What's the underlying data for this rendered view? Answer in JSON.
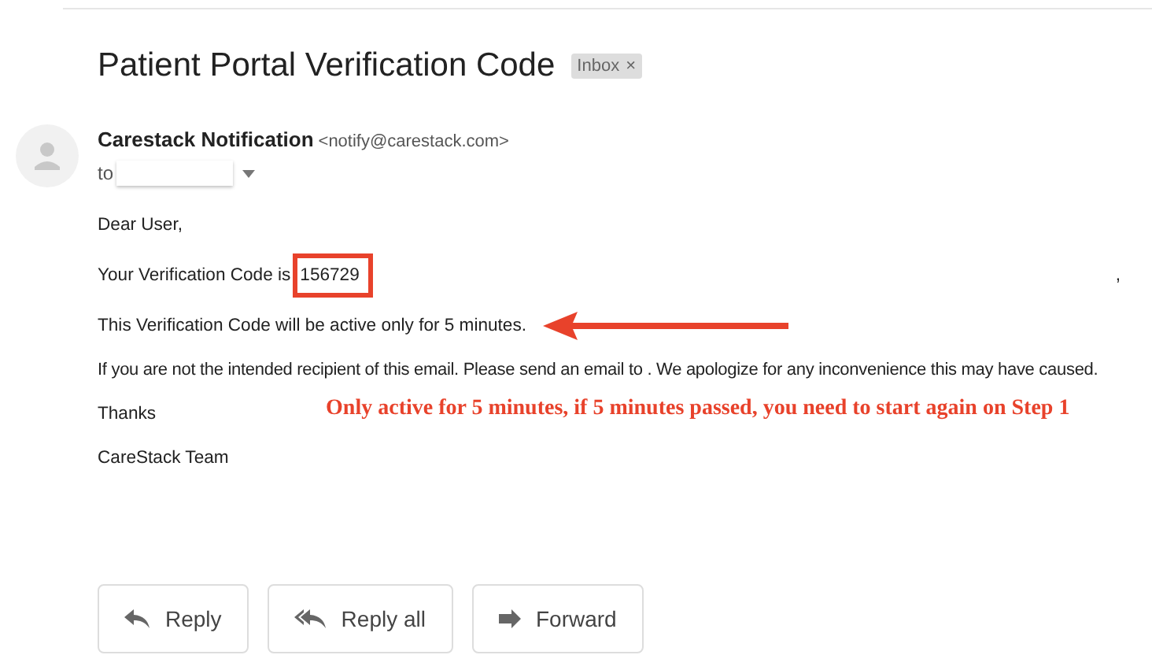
{
  "subject": "Patient Portal Verification Code",
  "label": {
    "text": "Inbox",
    "close": "×"
  },
  "sender": {
    "name": "Carestack Notification",
    "email": "<notify@carestack.com>",
    "to_label": "to"
  },
  "body": {
    "greeting": "Dear User,",
    "code_prefix": "Your Verification Code is",
    "code": "156729",
    "stray_mark": ",",
    "validity": "This Verification Code will be active only for 5 minutes.",
    "disclaimer": "If you are not the intended recipient of this email. Please send an email to . We apologize for any inconvenience this may have caused.",
    "thanks": "Thanks",
    "signature": "CareStack Team"
  },
  "annotation": "Only active for 5 minutes, if 5 minutes passed, you need to start again on Step 1",
  "buttons": [
    {
      "kind": "reply",
      "label": "Reply"
    },
    {
      "kind": "reply_all",
      "label": "Reply all"
    },
    {
      "kind": "forward",
      "label": "Forward"
    }
  ]
}
